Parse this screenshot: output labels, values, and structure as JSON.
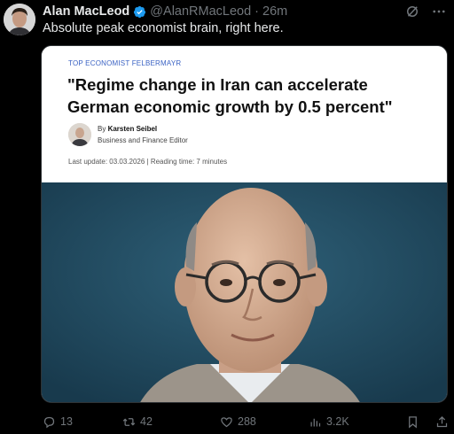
{
  "tweet": {
    "author_name": "Alan MacLeod",
    "handle_time": "@AlanRMacLeod · 26m",
    "text": "Absolute peak economist brain, right here."
  },
  "article": {
    "kicker": "TOP ECONOMIST FELBERMAYR",
    "headline": "\"Regime change in Iran can accelerate German economic growth by 0.5 percent\"",
    "by": "By",
    "author": "Karsten Seibel",
    "role": "Business and Finance Editor",
    "meta": "Last update: 03.03.2026 | Reading time: 7 minutes"
  },
  "actions": {
    "replies": "13",
    "retweets": "42",
    "likes": "288",
    "views": "3.2K"
  },
  "colors": {
    "background": "#000000",
    "verified": "#1d9bf0",
    "kicker": "#3b63c4",
    "muted": "#71767b"
  }
}
